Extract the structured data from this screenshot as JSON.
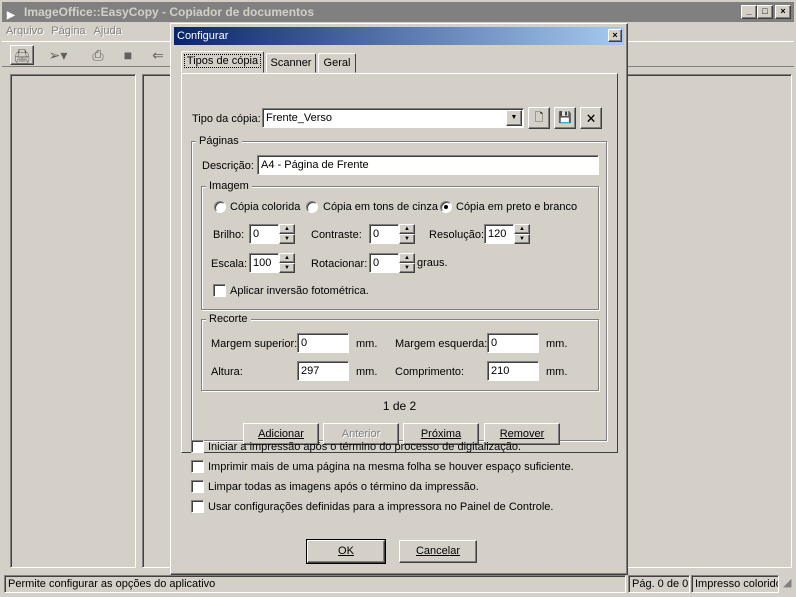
{
  "app": {
    "title": "ImageOffice::EasyCopy - Copiador de documentos",
    "menu": [
      "Arquivo",
      "Página",
      "Ajuda"
    ],
    "caption_buttons": {
      "minimize": "_",
      "maximize": "□",
      "close": "×"
    },
    "toolbar_icons": [
      "printer-icon",
      "scan-arrow-icon",
      "print-icon",
      "stop-icon",
      "back-arrow-icon"
    ],
    "status": {
      "message": "Permite configurar as opções do aplicativo",
      "page": "Pág. 0 de 0",
      "mode": "Impresso colorido"
    }
  },
  "dialog": {
    "title": "Configurar",
    "close": "×",
    "tabs": [
      "Tipos de cópia",
      "Scanner",
      "Geral"
    ],
    "copy_type": {
      "label": "Tipo da cópia:",
      "value": "Frente_Verso"
    },
    "pages": {
      "group_title": "Páginas",
      "description_label": "Descrição:",
      "description_value": "A4 - Página de Frente",
      "image": {
        "group_title": "Imagem",
        "radios": [
          "Cópia colorida",
          "Cópia em tons de cinza",
          "Cópia em preto e branco"
        ],
        "selected_index": 2,
        "brightness_label": "Brilho:",
        "brightness_value": "0",
        "contrast_label": "Contraste:",
        "contrast_value": "0",
        "resolution_label": "Resolução:",
        "resolution_value": "120",
        "scale_label": "Escala:",
        "scale_value": "100",
        "rotate_label": "Rotacionar:",
        "rotate_value": "0",
        "rotate_unit": "graus.",
        "invert_label": "Aplicar inversão fotométrica."
      },
      "crop": {
        "group_title": "Recorte",
        "top_margin_label": "Margem superior:",
        "top_margin_value": "0",
        "left_margin_label": "Margem esquerda:",
        "left_margin_value": "0",
        "height_label": "Altura:",
        "height_value": "297",
        "length_label": "Comprimento:",
        "length_value": "210",
        "unit": "mm."
      },
      "pager": "1 de 2",
      "buttons": {
        "add": "Adicionar",
        "previous": "Anterior",
        "next": "Próxima",
        "remove": "Remover"
      }
    },
    "options": [
      "Iniciar a impressão após o término do processo de digitalização.",
      "Imprimir mais de uma página na mesma folha se houver espaço suficiente.",
      "Limpar todas as imagens após o término da impressão.",
      "Usar configurações definidas para a impressora no Painel de Controle."
    ],
    "ok": "OK",
    "cancel": "Cancelar"
  }
}
